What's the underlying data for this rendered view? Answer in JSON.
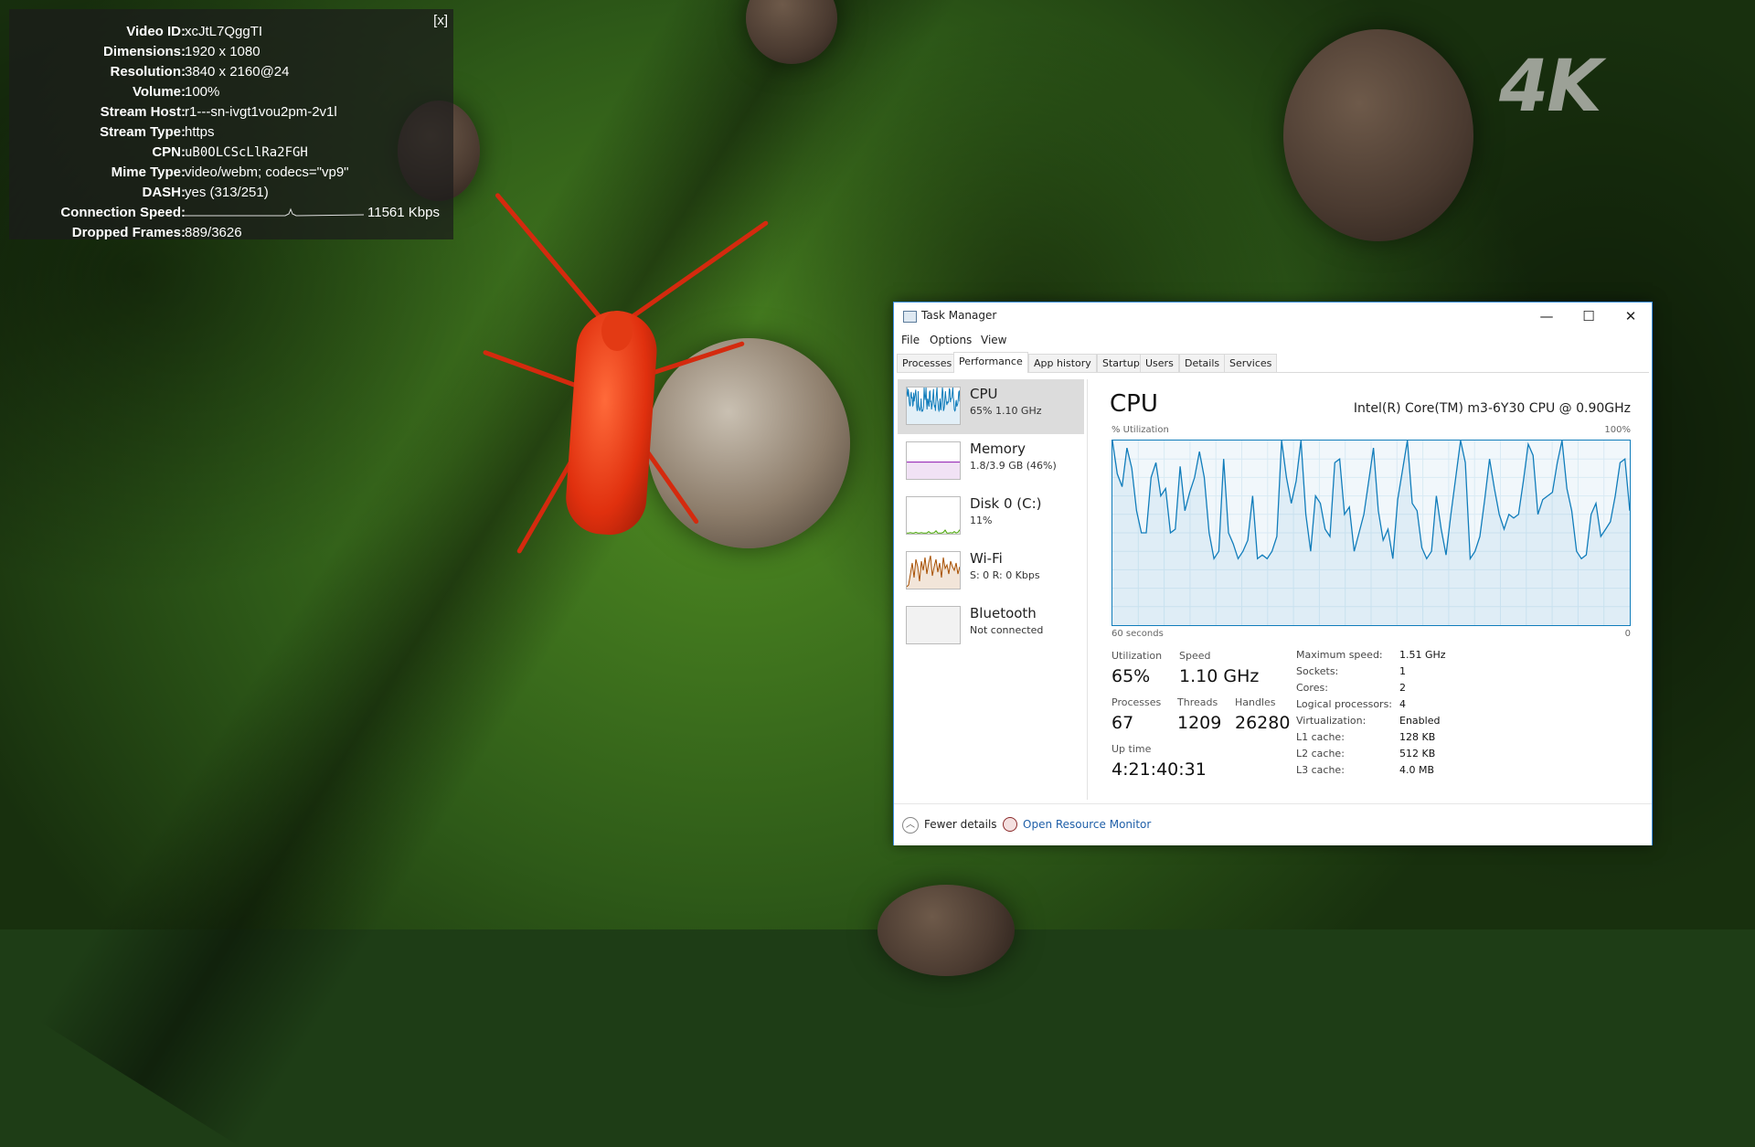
{
  "video_overlay": {
    "logo_text": "4K",
    "stats": {
      "close_label": "[x]",
      "rows": [
        {
          "label": "Video ID:",
          "value": "xcJtL7QggTI"
        },
        {
          "label": "Dimensions:",
          "value": "1920 x 1080"
        },
        {
          "label": "Resolution:",
          "value": "3840 x 2160@24"
        },
        {
          "label": "Volume:",
          "value": "100%"
        },
        {
          "label": "Stream Host:",
          "value": "r1---sn-ivgt1vou2pm-2v1l"
        },
        {
          "label": "Stream Type:",
          "value": "https"
        },
        {
          "label": "CPN:",
          "value": "uB0OLCScLlRa2FGH"
        },
        {
          "label": "Mime Type:",
          "value": "video/webm; codecs=\"vp9\""
        },
        {
          "label": "DASH:",
          "value": "yes (313/251)"
        },
        {
          "label": "Connection Speed:",
          "value": "11561 Kbps"
        },
        {
          "label": "Dropped Frames:",
          "value": "889/3626"
        }
      ]
    }
  },
  "task_manager": {
    "window_title": "Task Manager",
    "window_buttons": {
      "minimize": "—",
      "maximize": "☐",
      "close": "✕"
    },
    "menu": [
      "File",
      "Options",
      "View"
    ],
    "tabs": [
      "Processes",
      "Performance",
      "App history",
      "Startup",
      "Users",
      "Details",
      "Services"
    ],
    "active_tab": "Performance",
    "sidebar": [
      {
        "name": "CPU",
        "sub": "65%  1.10 GHz",
        "selected": true,
        "color": "#117dbb"
      },
      {
        "name": "Memory",
        "sub": "1.8/3.9 GB (46%)",
        "selected": false,
        "color": "#8b12ae"
      },
      {
        "name": "Disk 0 (C:)",
        "sub": "11%",
        "selected": false,
        "color": "#4da60c"
      },
      {
        "name": "Wi-Fi",
        "sub": "S: 0  R: 0 Kbps",
        "selected": false,
        "color": "#a74f01"
      },
      {
        "name": "Bluetooth",
        "sub": "Not connected",
        "selected": false,
        "color": "#999999"
      }
    ],
    "detail": {
      "title": "CPU",
      "model": "Intel(R) Core(TM) m3-6Y30 CPU @ 0.90GHz",
      "y_label": "% Utilization",
      "y_max_label": "100%",
      "x_left_label": "60 seconds",
      "x_right_label": "0",
      "graph_color": "#117dbb",
      "utilization_history": [
        100,
        82,
        75,
        96,
        85,
        62,
        50,
        50,
        80,
        88,
        70,
        74,
        50,
        52,
        86,
        62,
        72,
        80,
        94,
        80,
        50,
        36,
        40,
        90,
        50,
        44,
        36,
        40,
        46,
        70,
        36,
        38,
        36,
        40,
        48,
        100,
        80,
        66,
        78,
        100,
        60,
        40,
        70,
        66,
        52,
        48,
        88,
        90,
        60,
        64,
        40,
        50,
        60,
        78,
        96,
        62,
        46,
        52,
        36,
        68,
        84,
        100,
        66,
        62,
        42,
        36,
        40,
        70,
        52,
        38,
        60,
        80,
        100,
        88,
        36,
        40,
        48,
        68,
        90,
        74,
        60,
        52,
        60,
        58,
        60,
        78,
        98,
        92,
        60,
        68,
        70,
        72,
        88,
        100,
        74,
        62,
        40,
        36,
        38,
        60,
        66,
        48,
        52,
        56,
        70,
        88,
        90,
        62
      ],
      "stats": {
        "utilization_label": "Utilization",
        "utilization": "65%",
        "speed_label": "Speed",
        "speed": "1.10 GHz",
        "processes_label": "Processes",
        "processes": "67",
        "threads_label": "Threads",
        "threads": "1209",
        "handles_label": "Handles",
        "handles": "26280",
        "uptime_label": "Up time",
        "uptime": "4:21:40:31"
      },
      "specs": [
        {
          "label": "Maximum speed:",
          "value": "1.51 GHz"
        },
        {
          "label": "Sockets:",
          "value": "1"
        },
        {
          "label": "Cores:",
          "value": "2"
        },
        {
          "label": "Logical processors:",
          "value": "4"
        },
        {
          "label": "Virtualization:",
          "value": "Enabled"
        },
        {
          "label": "L1 cache:",
          "value": "128 KB"
        },
        {
          "label": "L2 cache:",
          "value": "512 KB"
        },
        {
          "label": "L3 cache:",
          "value": "4.0 MB"
        }
      ]
    },
    "footer": {
      "fewer_details": "Fewer details",
      "open_resource_monitor": "Open Resource Monitor"
    }
  }
}
